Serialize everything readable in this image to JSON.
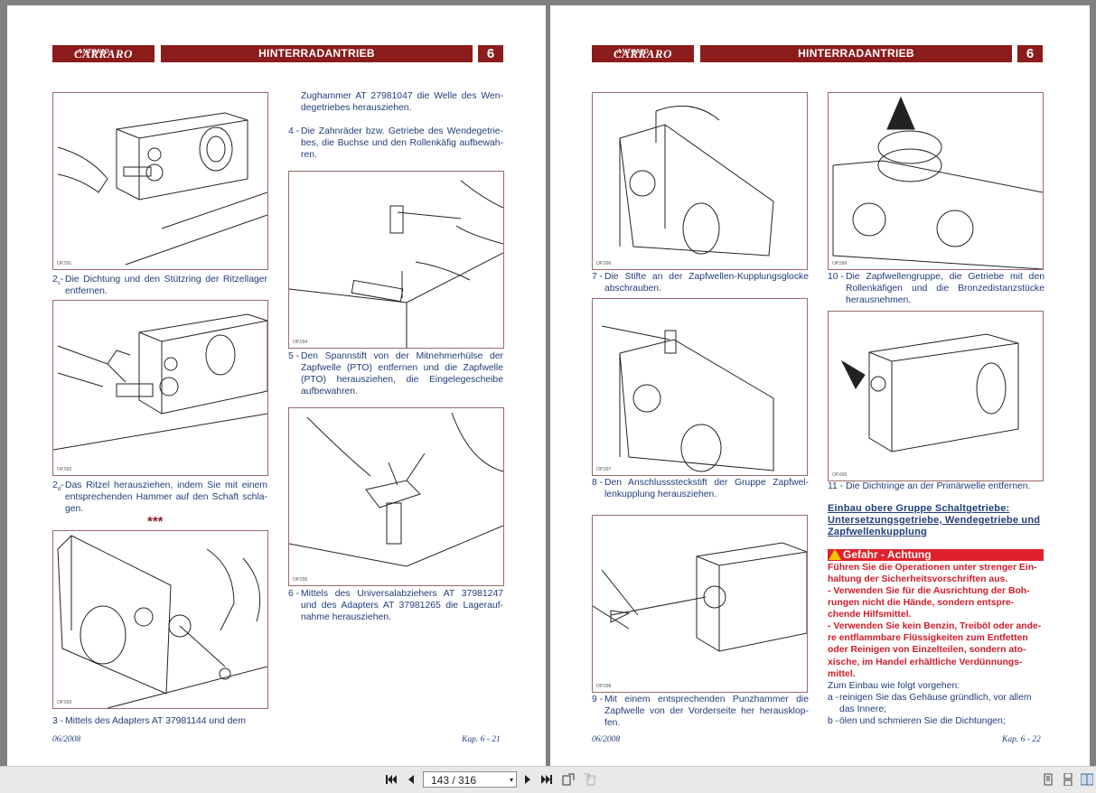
{
  "header": {
    "logo_text": "CARRARO",
    "logo_small": "ANTONIO",
    "title": "HINTERRADANTRIEB",
    "chapter": "6"
  },
  "left_page": {
    "figures": [
      "OP.591",
      "OP.592",
      "OP.593",
      "OP.594",
      "OP.595"
    ],
    "steps": [
      {
        "num": "2",
        "sub": "c",
        "sep": "-",
        "text": "Die Dichtung und den Stützring der Ritzellager entfernen."
      },
      {
        "num": "2",
        "sub": "d",
        "sep": "-",
        "text": "Das Ritzel herausziehen, indem Sie mit einem entsprechenden Hammer auf den Schaft schla-gen."
      },
      {
        "num": "3",
        "sub": "",
        "sep": " -",
        "text": "Mittels des Adapters AT 37981144 und dem"
      },
      {
        "num": "",
        "sub": "",
        "sep": "",
        "text": "Zughammer AT 27981047 die Welle des Wen-degetriebes herausziehen."
      },
      {
        "num": "4",
        "sub": "",
        "sep": " -",
        "text": "Die Zahnräder bzw. Getriebe des Wendegetrie-bes, die Buchse und den Rollenkäfig aufbewah-ren."
      },
      {
        "num": "5",
        "sub": "",
        "sep": " -",
        "text": "Den Spannstift von der Mitnehmerhülse der Zapfwelle (PTO) entfernen und die Zapfwelle (PTO) herausziehen, die Eingelegescheibe aufbewahren."
      },
      {
        "num": "6",
        "sub": "",
        "sep": " -",
        "text": "Mittels des Universalabziehers AT 37981247 und des Adapters AT 37981265 die Lagerauf-nahme herausziehen."
      }
    ],
    "stars": "***",
    "footer_date": "06/2008",
    "footer_page": "Kap. 6 - 21"
  },
  "right_page": {
    "figures": [
      "OP.596",
      "OP.597",
      "OP.598",
      "OP.599",
      "OP.600"
    ],
    "steps": [
      {
        "num": "7",
        "sep": " -",
        "text": "Die Stifte an der Zapfwellen-Kupplungsglocke abschrauben."
      },
      {
        "num": "8",
        "sep": " -",
        "text": "Den Anschlusssteckstift der Gruppe Zapfwel-lenkupplung herausziehen."
      },
      {
        "num": "9",
        "sep": " -",
        "text": "Mit einem entsprechenden Punzhammer die Zapfwelle von der Vorderseite her herausklop-fen."
      },
      {
        "num": "10",
        "sep": " -",
        "text": "Die Zapfwellengruppe, die Getriebe mit den Rollenkäfigen und die Bronzedistanzstücke herausnehmen."
      },
      {
        "num": "11",
        "sep": " -",
        "text": "Die Dichtringe an der Primärwelle entfernen."
      }
    ],
    "section_title": "Einbau obere Gruppe Schaltgetriebe: Untersetzungsgetriebe, Wendegetriebe und Zapfwellenkupplung",
    "danger_label": "Gefahr - Achtung",
    "warning_intro": "Führen Sie die Operationen unter strenger Ein-haltung der Sicherheitsvorschriften aus.",
    "warning_items": [
      "- Verwenden Sie für die Ausrichtung der Boh-rungen nicht die Hände, sondern entspre-chende Hilfsmittel.",
      "- Verwenden Sie kein Benzin, Treiböl oder ande-re entflammbare Flüssigkeiten zum Entfetten oder Reinigen von Einzelteilen, sondern ato-xische, im Handel erhältliche Verdünnungs-mittel."
    ],
    "procedure_intro": "Zum Einbau wie folgt vorgehen:",
    "procedure_items": [
      {
        "letter": "a -",
        "text": "reinigen Sie das Gehäuse gründlich, vor allem das Innere;"
      },
      {
        "letter": "b -",
        "text": "ölen und schmieren Sie die Dichtungen;"
      }
    ],
    "footer_date": "06/2008",
    "footer_page": "Kap. 6 - 22"
  },
  "toolbar": {
    "page_field": "143 / 316"
  },
  "colors": {
    "brand": "#8c1c1c",
    "text": "#1f3d7a",
    "danger": "#e0212b",
    "warning_text": "#d01c2a"
  }
}
